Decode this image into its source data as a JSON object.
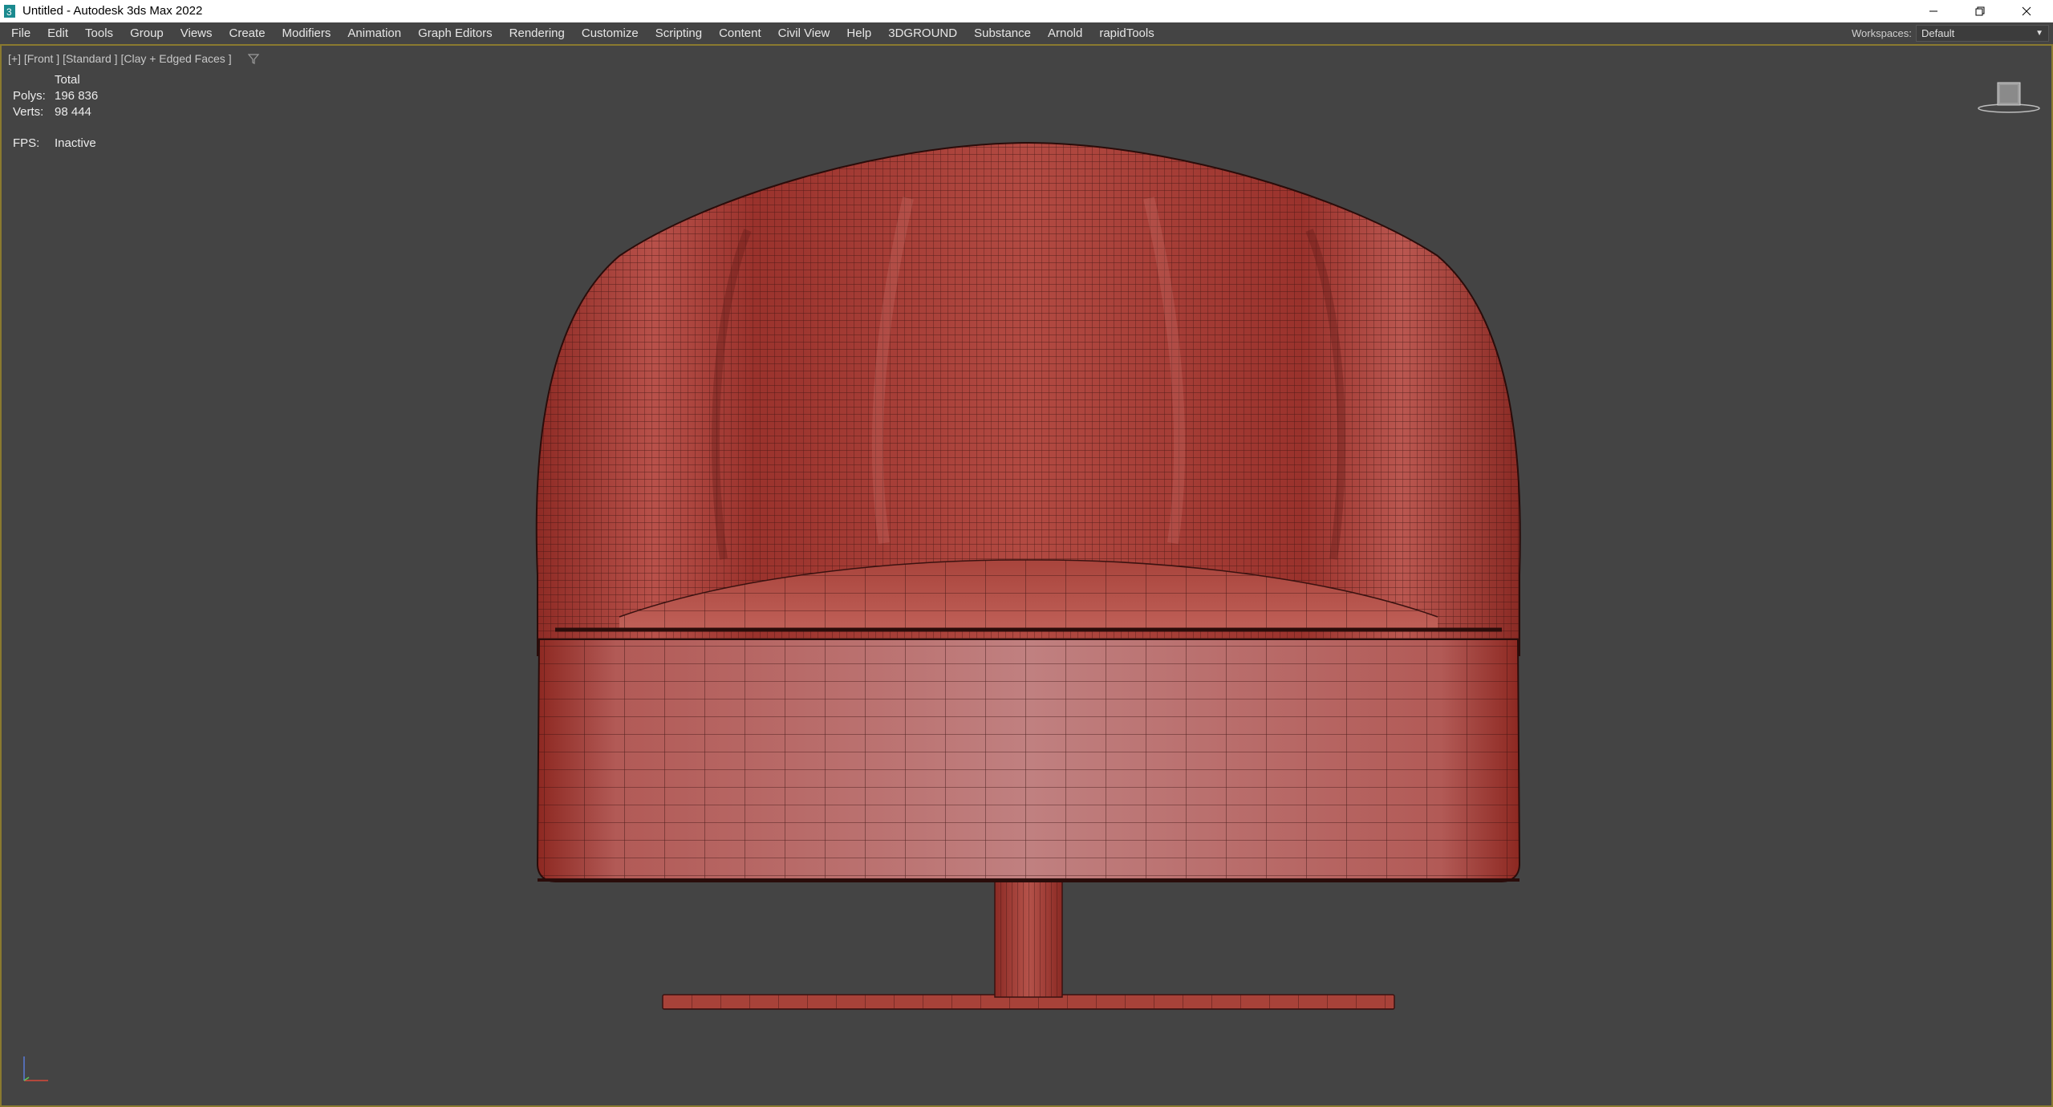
{
  "window": {
    "title": "Untitled - Autodesk 3ds Max 2022",
    "minimize_icon": "minimize-icon",
    "restore_icon": "restore-icon",
    "close_icon": "close-icon"
  },
  "menu": [
    "File",
    "Edit",
    "Tools",
    "Group",
    "Views",
    "Create",
    "Modifiers",
    "Animation",
    "Graph Editors",
    "Rendering",
    "Customize",
    "Scripting",
    "Content",
    "Civil View",
    "Help",
    "3DGROUND",
    "Substance",
    "Arnold",
    "rapidTools"
  ],
  "workspace": {
    "label": "Workspaces:",
    "value": "Default"
  },
  "viewport": {
    "label": "[+] [Front ] [Standard ] [Clay + Edged Faces ]",
    "stats": {
      "header": "Total",
      "polys_label": "Polys:",
      "polys_value": "196 836",
      "verts_label": "Verts:",
      "verts_value": "98 444",
      "fps_label": "FPS:",
      "fps_value": "Inactive"
    },
    "colors": {
      "mesh": "#b5423a",
      "wire": "#3a1210",
      "background": "#444444",
      "border": "#8a7a2f"
    }
  }
}
